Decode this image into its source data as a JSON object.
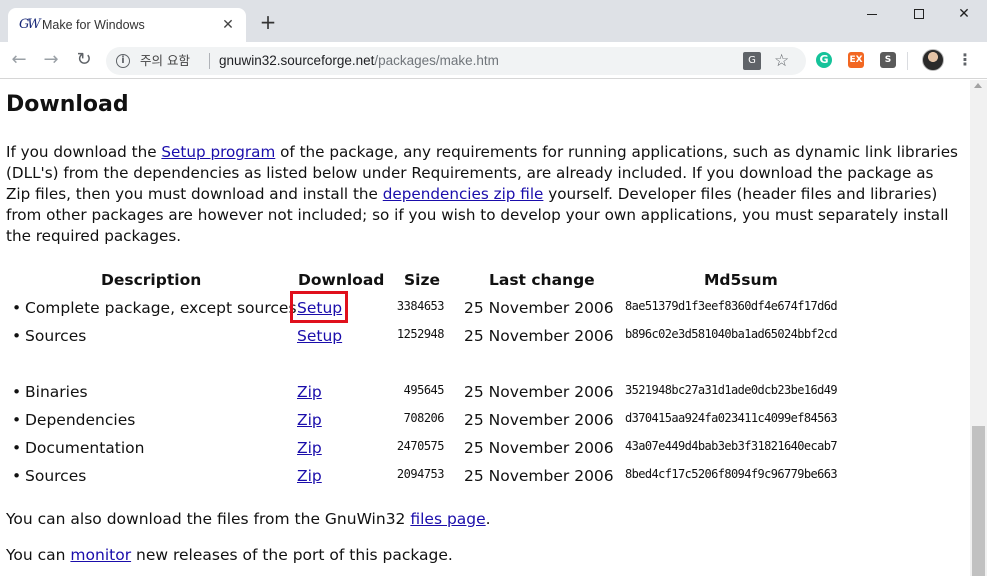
{
  "browser": {
    "tab_title": "Make for Windows",
    "favicon_text": "GW",
    "security_label": "주의 요함",
    "url_host": "gnuwin32.sourceforge.net",
    "url_path": "/packages/make.htm",
    "new_tab_symbol": "+",
    "close_symbol": "✕"
  },
  "content": {
    "heading": "Download",
    "intro_1": "If you download the ",
    "intro_link_1": "Setup program",
    "intro_2": " of the package, any requirements for running applications, such as dynamic link libraries (DLL's) from the dependencies as listed below under Requirements, are already included. If you download the package as Zip files, then you must download and install the ",
    "intro_link_2": "dependencies zip file",
    "intro_3": " yourself. Developer files (header files and libraries) from other packages are however not included; so if you wish to develop your own applications, you must separately install the required packages.",
    "table_headers": {
      "description": "Description",
      "download": "Download",
      "size": "Size",
      "last_change": "Last change",
      "md5sum": "Md5sum"
    },
    "rows": [
      {
        "description": "Complete package, except sources",
        "download": "Setup",
        "size": "3384653",
        "date": "25 November 2006",
        "md5": "8ae51379d1f3eef8360df4e674f17d6d"
      },
      {
        "description": "Sources",
        "download": "Setup",
        "size": "1252948",
        "date": "25 November 2006",
        "md5": "b896c02e3d581040ba1ad65024bbf2cd"
      },
      {
        "description": "Binaries",
        "download": "Zip",
        "size": "495645",
        "date": "25 November 2006",
        "md5": "3521948bc27a31d1ade0dcb23be16d49"
      },
      {
        "description": "Dependencies",
        "download": "Zip",
        "size": "708206",
        "date": "25 November 2006",
        "md5": "d370415aa924fa023411c4099ef84563"
      },
      {
        "description": "Documentation",
        "download": "Zip",
        "size": "2470575",
        "date": "25 November 2006",
        "md5": "43a07e449d4bab3eb3f31821640ecab7"
      },
      {
        "description": "Sources",
        "download": "Zip",
        "size": "2094753",
        "date": "25 November 2006",
        "md5": "8bed4cf17c5206f8094f9c96779be663"
      }
    ],
    "footer_1_text": "You can also download the files from the GnuWin32 ",
    "footer_1_link": "files page",
    "footer_1_end": ".",
    "footer_2_text": "You can ",
    "footer_2_link": "monitor",
    "footer_2_end": " new releases of the port of this package."
  },
  "colors": {
    "link": "#1a0dab",
    "highlight": "#e0101c"
  }
}
